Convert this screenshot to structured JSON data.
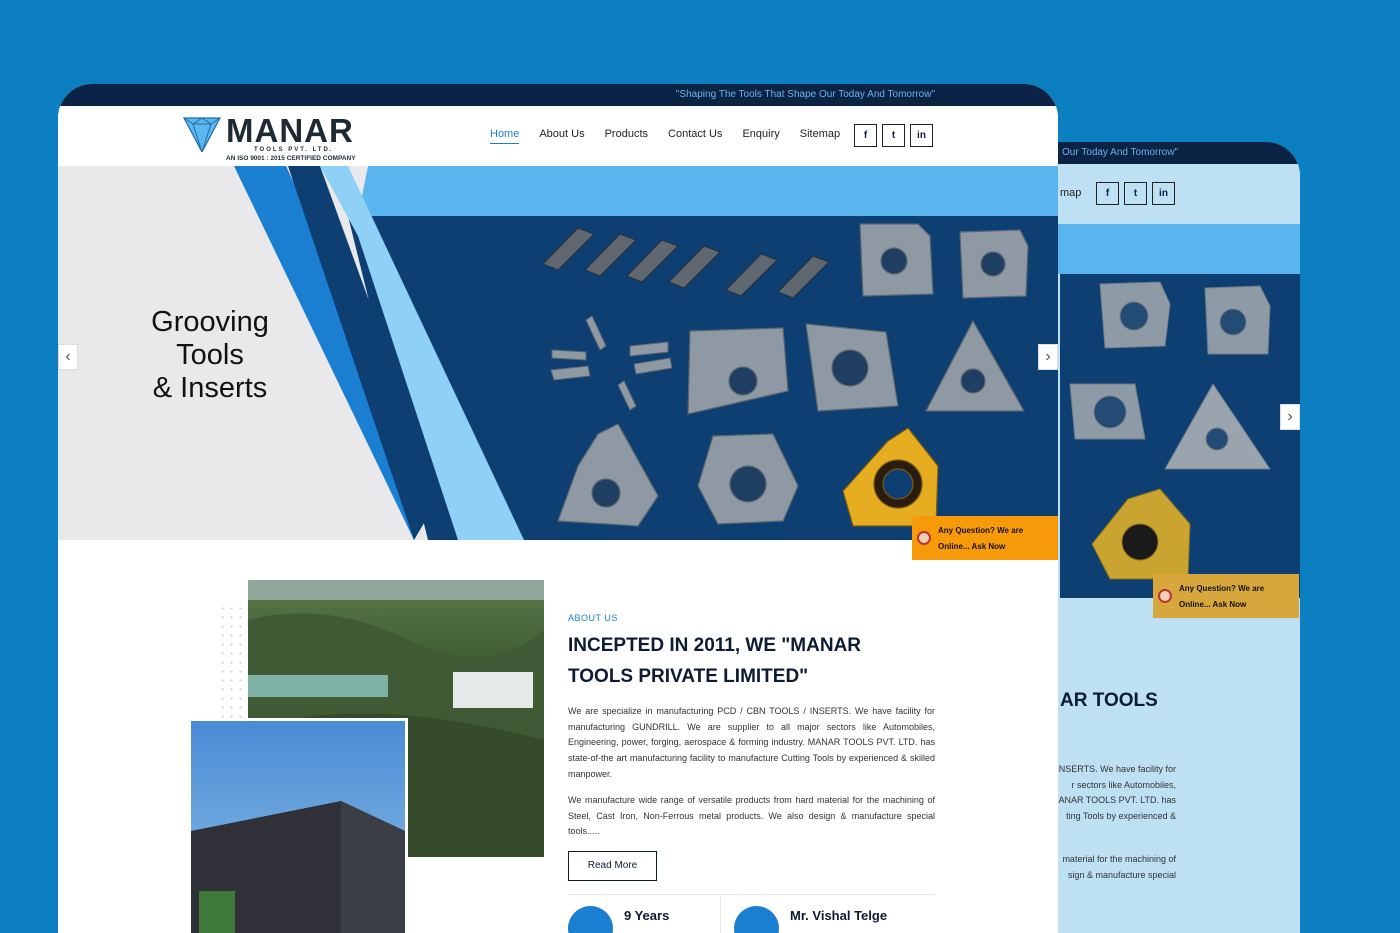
{
  "brand": {
    "name": "MANAR",
    "sub": "TOOLS PVT. LTD.",
    "iso": "AN ISO 9001 : 2015 CERTIFIED COMPANY"
  },
  "tagline": "\"Shaping The Tools That Shape Our Today And Tomorrow\"",
  "tagline_partial": "Our Today And Tomorrow\"",
  "nav": {
    "items": [
      "Home",
      "About Us",
      "Products",
      "Contact Us",
      "Enquiry",
      "Sitemap"
    ],
    "active": "Home",
    "partial": "map"
  },
  "social": {
    "facebook": "f",
    "twitter": "t",
    "linkedin": "in"
  },
  "hero": {
    "line1": "Grooving",
    "line2": "Tools",
    "line3": "& Inserts",
    "prev": "‹",
    "next": "›"
  },
  "chat": {
    "line1": "Any Question? We are",
    "line2": "Online... Ask Now"
  },
  "about": {
    "label": "ABOUT US",
    "heading": "INCEPTED IN 2011, WE \"MANAR TOOLS PRIVATE LIMITED\"",
    "heading_partial": "AR TOOLS",
    "p1": "We are specialize in manufacturing PCD / CBN TOOLS / INSERTS. We have facility for manufacturing GUNDRILL. We are supplier to all major sectors like Automobiles, Engineering, power, forging, aerospace & forming industry. MANAR TOOLS PVT. LTD. has state-of-the art manufacturing facility to manufacture Cutting Tools by experienced & skilled manpower.",
    "p2": "We manufacture wide range of versatile products from hard material for the machining of Steel, Cast Iron, Non-Ferrous metal products. We also design & manufacture special tools.....",
    "read_more": "Read More",
    "back_p1_lines": [
      "NSERTS. We have facility for",
      "r  sectors  like  Automobiles,",
      "MANAR TOOLS PVT. LTD. has",
      "ting Tools by experienced &"
    ],
    "back_p2_lines": [
      "material for the machining of",
      "sign & manufacture special"
    ]
  },
  "stats": [
    {
      "label": "9 Years"
    },
    {
      "label": "Mr. Vishal Telge"
    }
  ],
  "colors": {
    "bg": "#0b7fc0",
    "navy": "#0b2344",
    "accent": "#1a7fd0",
    "chat": "#f79a0a"
  }
}
